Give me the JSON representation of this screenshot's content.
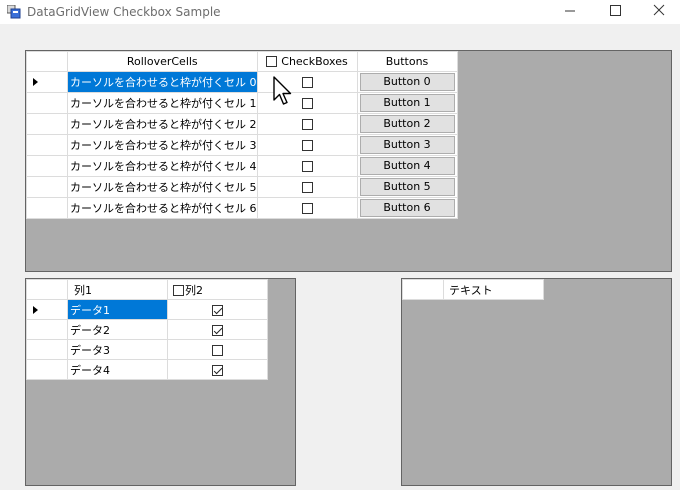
{
  "window": {
    "title": "DataGridView Checkbox Sample",
    "min_glyph": "—",
    "max_glyph": "☐",
    "close_glyph": "✕"
  },
  "grid1": {
    "headers": [
      "RolloverCells",
      "CheckBoxes",
      "Buttons"
    ],
    "rows": [
      {
        "text": "カーソルを合わせると枠が付くセル 0",
        "checked": false,
        "button": "Button 0"
      },
      {
        "text": "カーソルを合わせると枠が付くセル 1",
        "checked": false,
        "button": "Button 1"
      },
      {
        "text": "カーソルを合わせると枠が付くセル 2",
        "checked": false,
        "button": "Button 2"
      },
      {
        "text": "カーソルを合わせると枠が付くセル 3",
        "checked": false,
        "button": "Button 3"
      },
      {
        "text": "カーソルを合わせると枠が付くセル 4",
        "checked": false,
        "button": "Button 4"
      },
      {
        "text": "カーソルを合わせると枠が付くセル 5",
        "checked": false,
        "button": "Button 5"
      },
      {
        "text": "カーソルを合わせると枠が付くセル 6",
        "checked": false,
        "button": "Button 6"
      }
    ]
  },
  "grid2": {
    "headers": [
      "列1",
      "列2"
    ],
    "rows": [
      {
        "text": "データ1",
        "checked": true
      },
      {
        "text": "データ2",
        "checked": true
      },
      {
        "text": "データ3",
        "checked": false
      },
      {
        "text": "データ4",
        "checked": true
      }
    ]
  },
  "grid3": {
    "headers": [
      "テキスト"
    ]
  },
  "colors": {
    "selection": "#0078d7",
    "grid_background": "#ababab"
  }
}
